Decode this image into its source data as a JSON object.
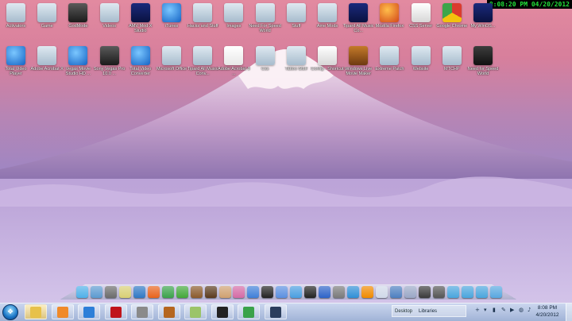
{
  "clock_overlay": "8:08:20 PM 04/20/2012",
  "desktop_row1": [
    {
      "label": "Activators",
      "icon": "folder-icon",
      "style": "g-folder"
    },
    {
      "label": "Game",
      "icon": "folder-icon",
      "style": "g-folder"
    },
    {
      "label": "GodMode",
      "icon": "godmode-icon",
      "style": "g-dark"
    },
    {
      "label": "Videos",
      "icon": "folder-icon",
      "style": "g-folder"
    },
    {
      "label": "AMV Mod X Studio",
      "icon": "amv-icon",
      "style": "g-navy"
    },
    {
      "label": "iTunes",
      "icon": "itunes-icon",
      "style": "g-blue"
    },
    {
      "label": "Hacks and Stuff",
      "icon": "folder-icon",
      "style": "g-folder"
    },
    {
      "label": "Images",
      "icon": "folder-icon",
      "style": "g-folder"
    },
    {
      "label": "Need For Speed World",
      "icon": "folder-icon",
      "style": "g-folder"
    },
    {
      "label": "Stuff",
      "icon": "folder-icon",
      "style": "g-folder"
    },
    {
      "label": "Ame Mods",
      "icon": "folder-icon",
      "style": "g-folder"
    },
    {
      "label": "Tipard All Music Co...",
      "icon": "tipard-icon",
      "style": "g-navy"
    },
    {
      "label": "Mozilla Firefox",
      "icon": "firefox-icon",
      "style": "g-orange"
    },
    {
      "label": "CSS Server",
      "icon": "document-icon",
      "style": "g-white"
    },
    {
      "label": "Google Chrome",
      "icon": "chrome-icon",
      "style": "g-chrome"
    },
    {
      "label": "My WinOS...",
      "icon": "phone-icon",
      "style": "g-navy"
    }
  ],
  "desktop_row2": [
    {
      "label": "Total Video Player",
      "icon": "video-player-icon",
      "style": "g-blue"
    },
    {
      "label": "Adobe Acrobat X",
      "icon": "folder-icon",
      "style": "g-folder"
    },
    {
      "label": "Vegas Movie Studio HD ...",
      "icon": "vegas-icon",
      "style": "g-blue"
    },
    {
      "label": "Sony Vegas Pro 10.0 ...",
      "icon": "sony-vegas-icon",
      "style": "g-dark"
    },
    {
      "label": "Total Video Converter",
      "icon": "converter-icon",
      "style": "g-blue"
    },
    {
      "label": "Microsoft Office",
      "icon": "folder-icon",
      "style": "g-folder"
    },
    {
      "label": "Tipard All Music Conv...",
      "icon": "folder-icon",
      "style": "g-folder"
    },
    {
      "label": "Adobe Acrobat 9 ...",
      "icon": "acrobat-icon",
      "style": "g-red"
    },
    {
      "label": "Css",
      "icon": "folder-icon",
      "style": "g-folder"
    },
    {
      "label": "Tattoo Stuff",
      "icon": "folder-icon",
      "style": "g-folder"
    },
    {
      "label": "Config - Shortcut",
      "icon": "config-icon",
      "style": "g-white"
    },
    {
      "label": "Windows Live Movie Maker",
      "icon": "movie-maker-icon",
      "style": "g-video"
    },
    {
      "label": "Extreme Patch",
      "icon": "folder-icon",
      "style": "g-folder"
    },
    {
      "label": "Website",
      "icon": "folder-icon",
      "style": "g-folder"
    },
    {
      "label": "MTCHP",
      "icon": "folder-icon",
      "style": "g-folder"
    },
    {
      "label": "Need for Speed World",
      "icon": "nfs-icon",
      "style": "g-nfs"
    }
  ],
  "dock_items": [
    {
      "icon": "finder-icon",
      "color": "#4fb0e8"
    },
    {
      "icon": "drive-icon",
      "color": "#5c9ad0"
    },
    {
      "icon": "settings-icon",
      "color": "#6b6b6b"
    },
    {
      "icon": "notes-icon",
      "color": "#d8cf74"
    },
    {
      "icon": "globe-icon",
      "color": "#2f78c4"
    },
    {
      "icon": "firefox-icon",
      "color": "#e8631c"
    },
    {
      "icon": "chrome-icon",
      "color": "#3aa24a"
    },
    {
      "icon": "leaf-icon",
      "color": "#43a83a"
    },
    {
      "icon": "photo-icon",
      "color": "#8a5a2c"
    },
    {
      "icon": "photo-icon",
      "color": "#5a3a1c"
    },
    {
      "icon": "pen-icon",
      "color": "#cfa070"
    },
    {
      "icon": "music-icon",
      "color": "#d46aa6"
    },
    {
      "icon": "help-icon",
      "color": "#3f7fd8"
    },
    {
      "icon": "nfs-icon",
      "color": "#222222"
    },
    {
      "icon": "help-icon",
      "color": "#5b8fe0"
    },
    {
      "icon": "lock-icon",
      "color": "#4a9ee0"
    },
    {
      "icon": "record-icon",
      "color": "#222222"
    },
    {
      "icon": "xp-icon",
      "color": "#2d63c8"
    },
    {
      "icon": "wing-icon",
      "color": "#7a7a7a"
    },
    {
      "icon": "refresh-icon",
      "color": "#2f8fd6"
    },
    {
      "icon": "vlc-icon",
      "color": "#f08a00"
    },
    {
      "icon": "mail-icon",
      "color": "#d0d8e8"
    },
    {
      "icon": "monitor-icon",
      "color": "#4d7fc0"
    },
    {
      "icon": "network-icon",
      "color": "#9aa7c6"
    },
    {
      "icon": "disc-icon",
      "color": "#3a3a3a"
    },
    {
      "icon": "gear-icon",
      "color": "#555555"
    },
    {
      "icon": "drive-icon",
      "color": "#4aa6dd"
    },
    {
      "icon": "drive-icon",
      "color": "#4aa6dd"
    },
    {
      "icon": "drive-icon",
      "color": "#4aa6dd"
    },
    {
      "icon": "trash-icon",
      "color": "#58a7e0"
    }
  ],
  "taskbar": {
    "start_glyph": "❖",
    "buttons": [
      {
        "name": "explorer",
        "color": "#e7c14a",
        "active": true
      },
      {
        "name": "media-player",
        "color": "#f08a2a",
        "active": false
      },
      {
        "name": "internet-explorer",
        "color": "#2d7fd8",
        "active": false
      },
      {
        "name": "acrobat",
        "color": "#c0141a",
        "active": false
      },
      {
        "name": "counter-strike",
        "color": "#8a8a8a",
        "active": false
      },
      {
        "name": "game-launcher",
        "color": "#b5661f",
        "active": false
      },
      {
        "name": "notes",
        "color": "#9bc469",
        "active": false
      },
      {
        "name": "nfs",
        "color": "#222222",
        "active": false
      },
      {
        "name": "chrome",
        "color": "#3aa24a",
        "active": false
      },
      {
        "name": "phone",
        "color": "#2b3d5c",
        "active": false
      }
    ],
    "address_prefix": "Desktop",
    "address_value": "Libraries",
    "clock_time": "8:08 PM",
    "clock_date": "4/20/2012",
    "tray_icons": [
      "+",
      "▾",
      "▮",
      "✎",
      "▶",
      "◍",
      "♪"
    ]
  }
}
